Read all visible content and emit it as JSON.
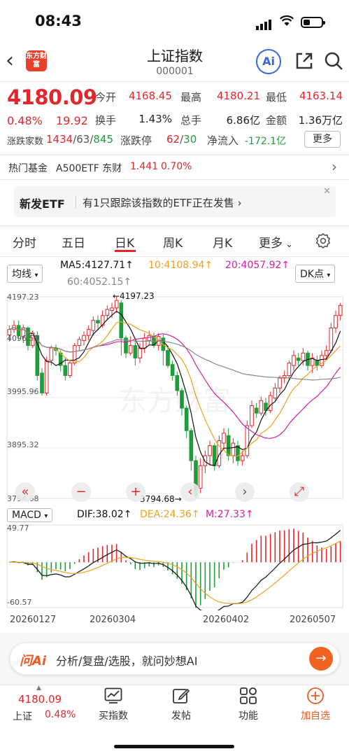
{
  "status": {
    "time": "08:43"
  },
  "nav": {
    "logo_text": "东方财富",
    "title": "上证指数",
    "code": "000001",
    "ai_label": "Ai"
  },
  "quote": {
    "price": "4180.09",
    "pct": "0.48%",
    "chg": "19.92",
    "open_label": "今开",
    "open": "4168.45",
    "high_label": "最高",
    "high": "4180.21",
    "low_label": "最低",
    "low": "4163.14",
    "turnover_label": "换手",
    "turnover": "1.43%",
    "volume_label": "总手",
    "volume": "6.86亿",
    "amount_label": "金额",
    "amount": "1.36万亿",
    "breadth_label": "涨跌家数",
    "breadth_up": "1434",
    "breadth_flat": "/63/",
    "breadth_down": "845",
    "limit_label": "涨跌停",
    "limit_up": "62",
    "limit_sep": "/",
    "limit_down": "30",
    "inflow_label": "净流入",
    "inflow": "-172.1亿",
    "more_label": "更多"
  },
  "hot_fund": {
    "label": "热门基金",
    "name": "A500ETF 东财",
    "price": "1.441",
    "pct": "0.70%"
  },
  "banner": {
    "title": "新发ETF",
    "text": "有1只跟踪该指数的ETF正在发售 ›",
    "close": "✕"
  },
  "tabs": [
    "分时",
    "五日",
    "日K",
    "周K",
    "月K",
    "更多"
  ],
  "active_tab": "日K",
  "chart_header": {
    "mode": "均线",
    "ma5": "MA5:4127.71↑",
    "ma10": "10:4108.94↑",
    "ma20": "20:4057.92↑",
    "ma60": "60:4052.15↑",
    "dk": "DK点"
  },
  "colors": {
    "up": "#e3262b",
    "down": "#1f9d3a",
    "ma5": "#111111",
    "ma10": "#f0a020",
    "ma20": "#d61fa0",
    "ma60": "#888888",
    "accent": "#f26322"
  },
  "chart_data": {
    "type": "candlestick",
    "y_ticks": [
      "4197.23",
      "4096.59",
      "3995.96",
      "3895.32",
      "3794.68"
    ],
    "ylim": [
      3794.68,
      4197.23
    ],
    "high_marker": "←4197.23",
    "low_marker": "3794.68→",
    "x_labels": [
      "20260127",
      "20260304",
      "20260402",
      "20260507"
    ],
    "candles": [
      [
        4121,
        4132,
        4108,
        4140
      ],
      [
        4132,
        4140,
        4125,
        4150
      ],
      [
        4140,
        4120,
        4110,
        4150
      ],
      [
        4118,
        4135,
        4105,
        4142
      ],
      [
        4135,
        4100,
        4090,
        4138
      ],
      [
        4100,
        4125,
        4095,
        4130
      ],
      [
        4120,
        4040,
        4030,
        4128
      ],
      [
        4045,
        4005,
        4000,
        4055
      ],
      [
        4005,
        4070,
        4000,
        4078
      ],
      [
        4070,
        4095,
        4060,
        4100
      ],
      [
        4095,
        4090,
        4080,
        4102
      ],
      [
        4085,
        4060,
        4048,
        4090
      ],
      [
        4060,
        4040,
        4030,
        4075
      ],
      [
        4040,
        4065,
        4035,
        4070
      ],
      [
        4065,
        4100,
        4060,
        4105
      ],
      [
        4100,
        4112,
        4090,
        4118
      ],
      [
        4110,
        4120,
        4100,
        4128
      ],
      [
        4120,
        4132,
        4110,
        4140
      ],
      [
        4130,
        4150,
        4120,
        4158
      ],
      [
        4150,
        4145,
        4130,
        4160
      ],
      [
        4140,
        4160,
        4135,
        4170
      ],
      [
        4160,
        4172,
        4150,
        4180
      ],
      [
        4170,
        4175,
        4155,
        4185
      ],
      [
        4175,
        4190,
        4165,
        4197.23
      ],
      [
        4185,
        4115,
        4080,
        4190
      ],
      [
        4115,
        4085,
        4075,
        4120
      ],
      [
        4085,
        4100,
        4080,
        4118
      ],
      [
        4100,
        4075,
        4060,
        4110
      ],
      [
        4075,
        4095,
        4065,
        4105
      ],
      [
        4095,
        4115,
        4085,
        4125
      ],
      [
        4110,
        4120,
        4100,
        4130
      ],
      [
        4118,
        4100,
        4095,
        4126
      ],
      [
        4100,
        4118,
        4090,
        4125
      ],
      [
        4115,
        4090,
        4060,
        4122
      ],
      [
        4090,
        4060,
        4055,
        4100
      ],
      [
        4062,
        4040,
        4030,
        4070
      ],
      [
        4040,
        4010,
        4000,
        4048
      ],
      [
        4010,
        3975,
        3960,
        4015
      ],
      [
        3975,
        3930,
        3915,
        3980
      ],
      [
        3930,
        3870,
        3850,
        3935
      ],
      [
        3870,
        3800,
        3794.68,
        3880
      ],
      [
        3815,
        3860,
        3805,
        3875
      ],
      [
        3860,
        3880,
        3845,
        3890
      ],
      [
        3880,
        3900,
        3860,
        3910
      ],
      [
        3900,
        3860,
        3850,
        3905
      ],
      [
        3860,
        3910,
        3855,
        3920
      ],
      [
        3905,
        3925,
        3890,
        3935
      ],
      [
        3920,
        3880,
        3870,
        3935
      ],
      [
        3880,
        3905,
        3865,
        3915
      ],
      [
        3900,
        3870,
        3860,
        3910
      ],
      [
        3870,
        3880,
        3860,
        3890
      ],
      [
        3880,
        3940,
        3875,
        3950
      ],
      [
        3940,
        3980,
        3935,
        3990
      ],
      [
        3975,
        3965,
        3955,
        3985
      ],
      [
        3965,
        3990,
        3960,
        3998
      ],
      [
        3985,
        3970,
        3960,
        3995
      ],
      [
        3970,
        4000,
        3965,
        4008
      ],
      [
        3995,
        4015,
        3990,
        4025
      ],
      [
        4015,
        4035,
        4005,
        4040
      ],
      [
        4035,
        4040,
        4025,
        4050
      ],
      [
        4040,
        4065,
        4030,
        4070
      ],
      [
        4060,
        4080,
        4050,
        4090
      ],
      [
        4075,
        4070,
        4060,
        4085
      ],
      [
        4070,
        4085,
        4060,
        4095
      ],
      [
        4085,
        4060,
        4050,
        4090
      ],
      [
        4060,
        4075,
        4045,
        4085
      ],
      [
        4070,
        4060,
        4050,
        4080
      ],
      [
        4060,
        4080,
        4055,
        4090
      ],
      [
        4080,
        4090,
        4070,
        4100
      ],
      [
        4090,
        4135,
        4085,
        4145
      ],
      [
        4135,
        4160,
        4125,
        4170
      ],
      [
        4160,
        4180.09,
        4150,
        4185
      ]
    ],
    "macd": {
      "dif_label": "DIF:38.02↑",
      "dea_label": "DEA:24.36↑",
      "m_label": "M:27.33↑",
      "macd_label": "MACD",
      "y_ticks": [
        "49.77",
        "-60.57"
      ],
      "ylim": [
        -60.57,
        49.77
      ]
    }
  },
  "ask": {
    "logo": "问Ai",
    "text": "分析/复盘/选股，就问妙想AI"
  },
  "bottom_nav": {
    "mini_price": "4180.09",
    "mini_name": "上证",
    "mini_pct": "0.48%",
    "items": [
      "买指数",
      "发帖",
      "功能",
      "加自选"
    ]
  }
}
